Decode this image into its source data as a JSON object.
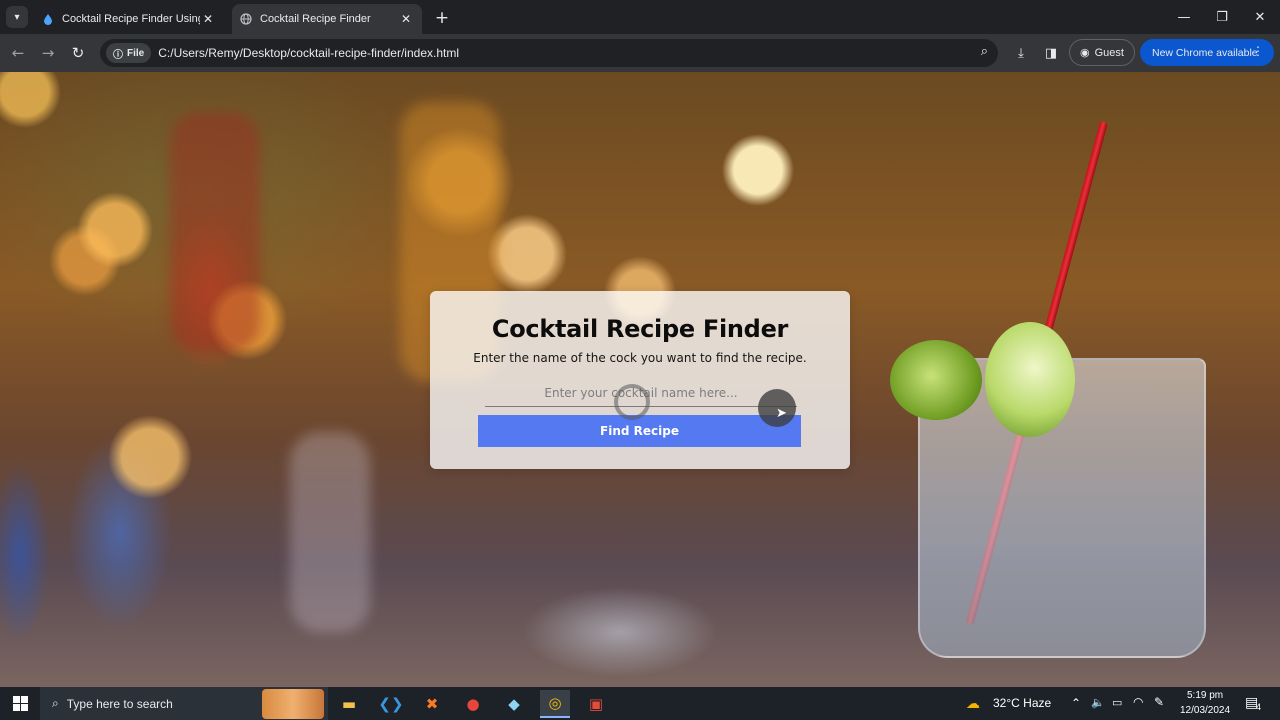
{
  "browser": {
    "tabs": [
      {
        "title": "Cocktail Recipe Finder Using HT",
        "active": false
      },
      {
        "title": "Cocktail Recipe Finder",
        "active": true
      }
    ],
    "chip_label": "File",
    "url": "C:/Users/Remy/Desktop/cocktail-recipe-finder/index.html",
    "profile_label": "Guest",
    "update_label": "New Chrome available"
  },
  "page": {
    "title": "Cocktail Recipe Finder",
    "subtitle": "Enter the name of the cock you want to find the recipe.",
    "input_placeholder": "Enter your cocktail name here...",
    "input_value": "",
    "button_label": "Find Recipe",
    "accent_color": "#5479f0"
  },
  "taskbar": {
    "search_placeholder": "Type here to search",
    "weather": "32°C  Haze",
    "time": "5:19 pm",
    "date": "12/03/2024",
    "notification_count": "4",
    "apps": [
      "file-explorer-icon",
      "vscode-icon",
      "xampp-icon",
      "chrome-alt-icon",
      "notepad-icon",
      "chrome-icon",
      "app-red-icon"
    ]
  }
}
